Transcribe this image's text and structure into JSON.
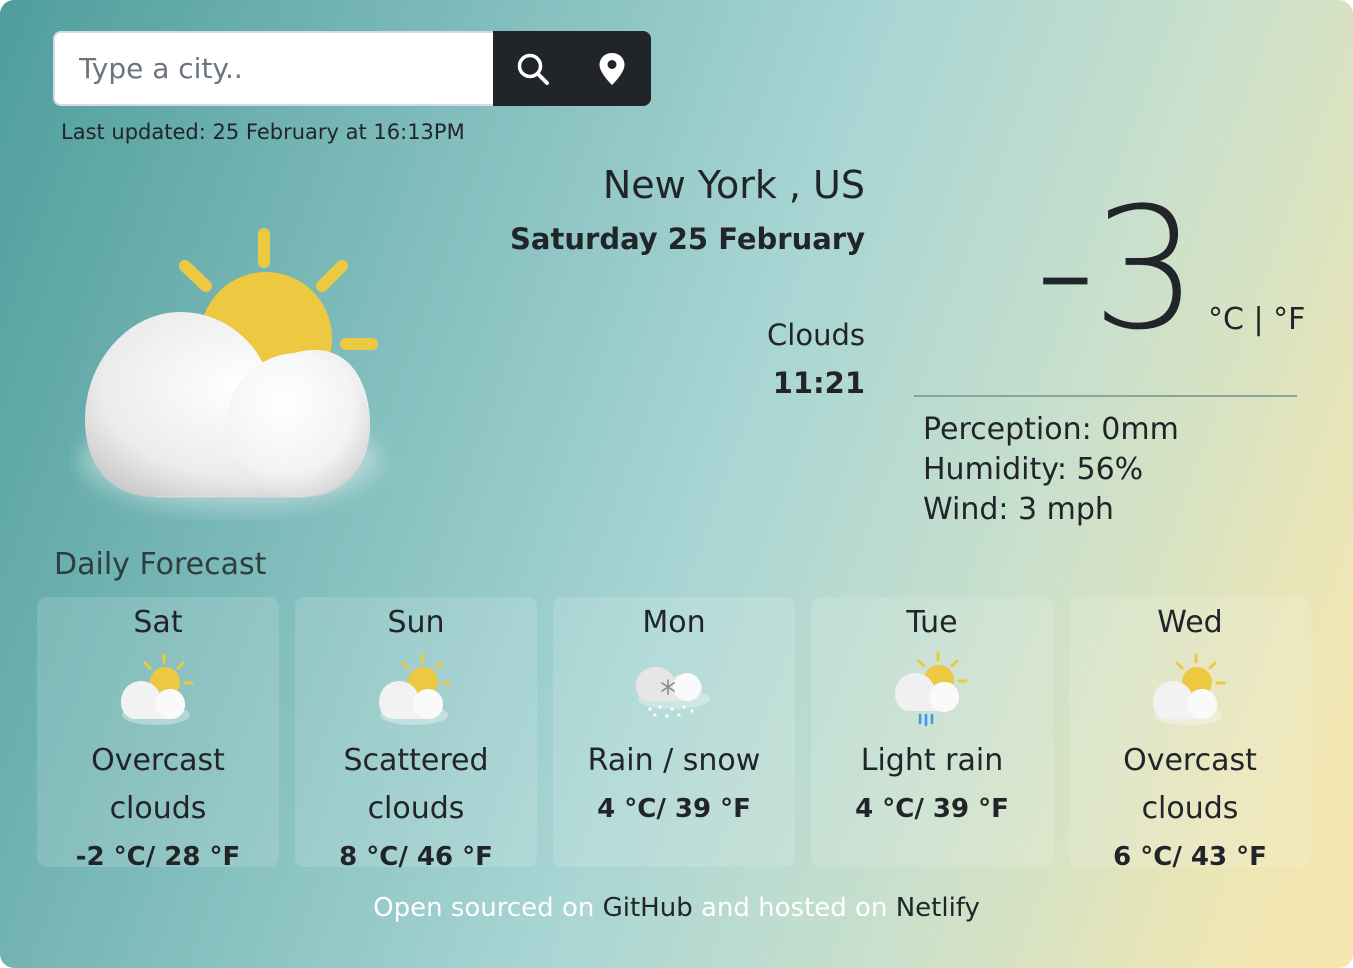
{
  "search": {
    "placeholder": "Type a city..",
    "value": ""
  },
  "icons": {
    "search": "search-icon",
    "location": "location-pin-icon"
  },
  "last_updated": "Last updated: 25 February at 16:13PM",
  "current": {
    "city": "New York , US",
    "date": "Saturday 25 February",
    "description": "Clouds",
    "time": "11:21",
    "temperature": "-3",
    "unit_c": "°C",
    "unit_sep": "|",
    "unit_f": "°F",
    "perception": "Perception: 0mm",
    "humidity": "Humidity: 56%",
    "wind": "Wind: 3 mph",
    "icon": "partly-cloudy-icon"
  },
  "forecast": {
    "title": "Daily Forecast",
    "days": [
      {
        "day": "Sat",
        "desc_line1": "Overcast",
        "desc_line2": "clouds",
        "temp": "-2 °C/ 28 °F",
        "icon": "partly-cloudy-icon"
      },
      {
        "day": "Sun",
        "desc_line1": "Scattered",
        "desc_line2": "clouds",
        "temp": "8 °C/ 46 °F",
        "icon": "partly-cloudy-icon"
      },
      {
        "day": "Mon",
        "desc_line1": "Rain / snow",
        "desc_line2": "",
        "temp": "4 °C/ 39 °F",
        "icon": "snow-cloud-icon"
      },
      {
        "day": "Tue",
        "desc_line1": "Light rain",
        "desc_line2": "",
        "temp": "4 °C/ 39 °F",
        "icon": "rain-cloud-icon"
      },
      {
        "day": "Wed",
        "desc_line1": "Overcast",
        "desc_line2": "clouds",
        "temp": "6 °C/ 43 °F",
        "icon": "partly-cloudy-icon"
      }
    ]
  },
  "footer": {
    "text1": "Open sourced on ",
    "link1": "GitHub",
    "text2": " and hosted on ",
    "link2": "Netlify"
  },
  "colors": {
    "sun": "#ecc940",
    "dark": "#212529"
  }
}
